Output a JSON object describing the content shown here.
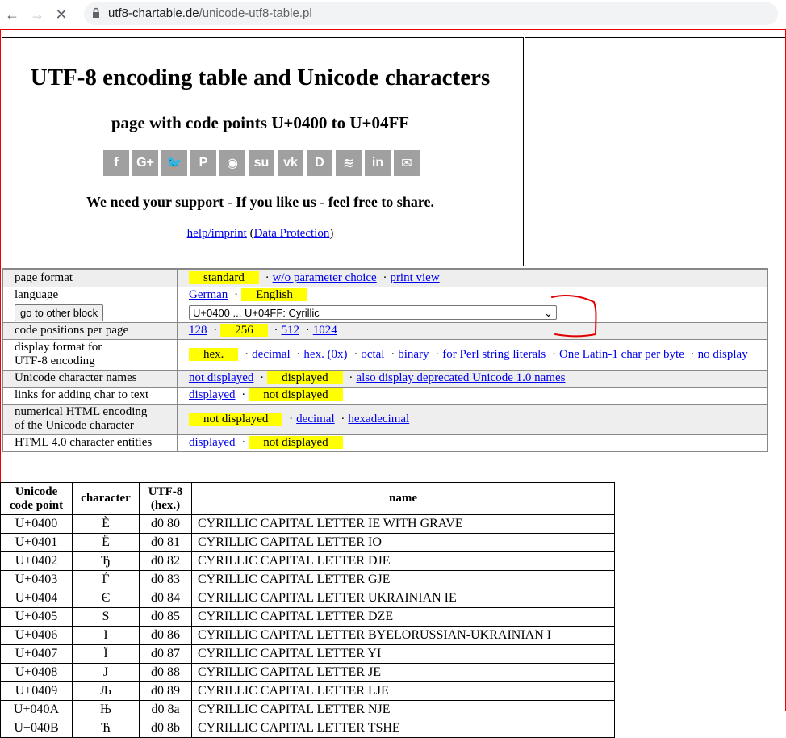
{
  "browser": {
    "url_domain": "utf8-chartable.de",
    "url_path": "/unicode-utf8-table.pl"
  },
  "header": {
    "title": "UTF-8 encoding table and Unicode characters",
    "subtitle": "page with code points U+0400 to U+04FF",
    "share_icons": [
      "facebook-icon",
      "google-plus-icon",
      "twitter-icon",
      "pinterest-icon",
      "reddit-icon",
      "stumbleupon-icon",
      "vk-icon",
      "digg-icon",
      "buffer-icon",
      "linkedin-icon",
      "email-icon"
    ],
    "share_glyphs": [
      "f",
      "G+",
      "🐦",
      "P",
      "◉",
      "su",
      "vk",
      "D",
      "≋",
      "in",
      "✉"
    ],
    "support_text": "We need your support - If you like us - feel free to share.",
    "help_link": "help/imprint",
    "paren_open": "(",
    "data_protection_link": "Data Protection",
    "paren_close": ")"
  },
  "settings": {
    "page_format": {
      "label": "page format",
      "selected": "standard",
      "options": [
        "w/o parameter choice",
        "print view"
      ]
    },
    "language": {
      "label": "language",
      "options_before": "German",
      "selected": "English"
    },
    "block": {
      "button": "go to other block",
      "selected": "U+0400 ... U+04FF: Cyrillic"
    },
    "code_positions": {
      "label": "code positions per page",
      "opt1": "128",
      "selected": "256",
      "opt3": "512",
      "opt4": "1024"
    },
    "display_format": {
      "label_line1": "display format for",
      "label_line2": "UTF-8 encoding",
      "selected": "hex.",
      "options": [
        "decimal",
        "hex. (0x)",
        "octal",
        "binary",
        "for Perl string literals",
        "One Latin-1 char per byte",
        "no display"
      ]
    },
    "char_names": {
      "label": "Unicode character names",
      "opt1": "not displayed",
      "selected": "displayed",
      "opt3": "also display deprecated Unicode 1.0 names"
    },
    "links_adding": {
      "label": "links for adding char to text",
      "opt1": "displayed",
      "selected": "not displayed"
    },
    "numerical_html": {
      "label_line1": "numerical HTML encoding",
      "label_line2": "of the Unicode character",
      "selected": "not displayed",
      "opt2": "decimal",
      "opt3": "hexadecimal"
    },
    "html_entities": {
      "label": "HTML 4.0 character entities",
      "opt1": "displayed",
      "selected": "not displayed"
    },
    "separator": "·"
  },
  "table": {
    "headers": {
      "code_point_1": "Unicode",
      "code_point_2": "code point",
      "character": "character",
      "utf8_1": "UTF-8",
      "utf8_2": "(hex.)",
      "name": "name"
    },
    "rows": [
      {
        "cp": "U+0400",
        "ch": "Ѐ",
        "hex": "d0 80",
        "name": "CYRILLIC CAPITAL LETTER IE WITH GRAVE"
      },
      {
        "cp": "U+0401",
        "ch": "Ё",
        "hex": "d0 81",
        "name": "CYRILLIC CAPITAL LETTER IO"
      },
      {
        "cp": "U+0402",
        "ch": "Ђ",
        "hex": "d0 82",
        "name": "CYRILLIC CAPITAL LETTER DJE"
      },
      {
        "cp": "U+0403",
        "ch": "Ѓ",
        "hex": "d0 83",
        "name": "CYRILLIC CAPITAL LETTER GJE"
      },
      {
        "cp": "U+0404",
        "ch": "Є",
        "hex": "d0 84",
        "name": "CYRILLIC CAPITAL LETTER UKRAINIAN IE"
      },
      {
        "cp": "U+0405",
        "ch": "Ѕ",
        "hex": "d0 85",
        "name": "CYRILLIC CAPITAL LETTER DZE"
      },
      {
        "cp": "U+0406",
        "ch": "І",
        "hex": "d0 86",
        "name": "CYRILLIC CAPITAL LETTER BYELORUSSIAN-UKRAINIAN I"
      },
      {
        "cp": "U+0407",
        "ch": "Ї",
        "hex": "d0 87",
        "name": "CYRILLIC CAPITAL LETTER YI"
      },
      {
        "cp": "U+0408",
        "ch": "Ј",
        "hex": "d0 88",
        "name": "CYRILLIC CAPITAL LETTER JE"
      },
      {
        "cp": "U+0409",
        "ch": "Љ",
        "hex": "d0 89",
        "name": "CYRILLIC CAPITAL LETTER LJE"
      },
      {
        "cp": "U+040A",
        "ch": "Њ",
        "hex": "d0 8a",
        "name": "CYRILLIC CAPITAL LETTER NJE"
      },
      {
        "cp": "U+040B",
        "ch": "Ћ",
        "hex": "d0 8b",
        "name": "CYRILLIC CAPITAL LETTER TSHE"
      }
    ]
  },
  "colors": {
    "highlight": "#ffff00",
    "link": "#0000ee",
    "row_alt": "#eeeeee",
    "annotation": "#e00000"
  }
}
